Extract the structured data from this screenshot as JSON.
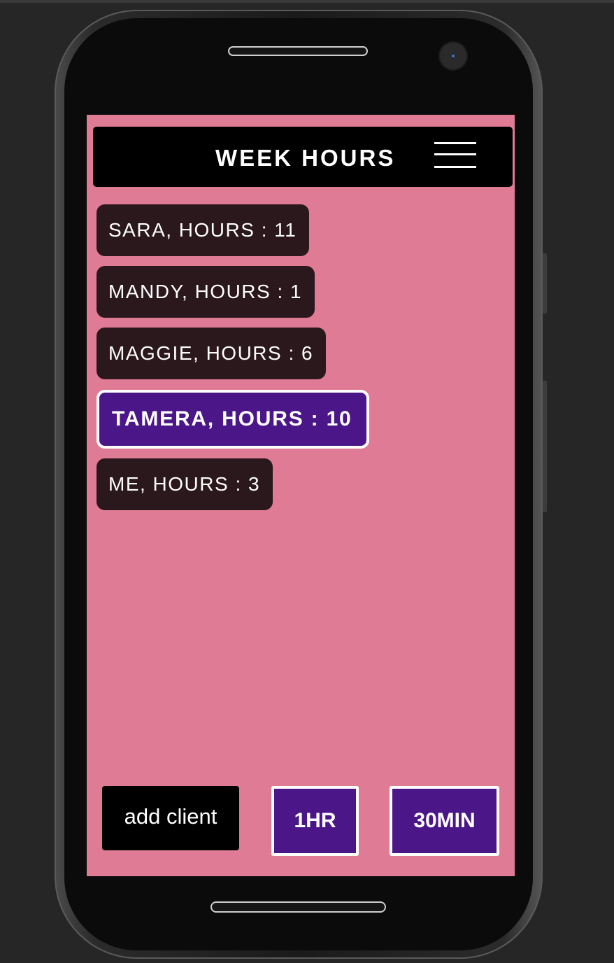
{
  "header": {
    "title": "WEEK HOURS",
    "menu_icon": "hamburger-menu-icon"
  },
  "clients": [
    {
      "label": "SARA, HOURS : 11",
      "name": "SARA",
      "hours": 11,
      "selected": false
    },
    {
      "label": "MANDY, HOURS : 1",
      "name": "MANDY",
      "hours": 1,
      "selected": false
    },
    {
      "label": "MAGGIE, HOURS : 6",
      "name": "MAGGIE",
      "hours": 6,
      "selected": false
    },
    {
      "label": "TAMERA, HOURS : 10",
      "name": "TAMERA",
      "hours": 10,
      "selected": true
    },
    {
      "label": "ME, HOURS : 3",
      "name": "ME",
      "hours": 3,
      "selected": false
    }
  ],
  "actions": {
    "add_client_label": "add client",
    "one_hour_label": "1HR",
    "thirty_min_label": "30MIN"
  },
  "colors": {
    "screen_background": "#e07b96",
    "header_background": "#000000",
    "client_item_background": "#2b181d",
    "selected_accent": "#4b1688",
    "text": "#ffffff"
  }
}
